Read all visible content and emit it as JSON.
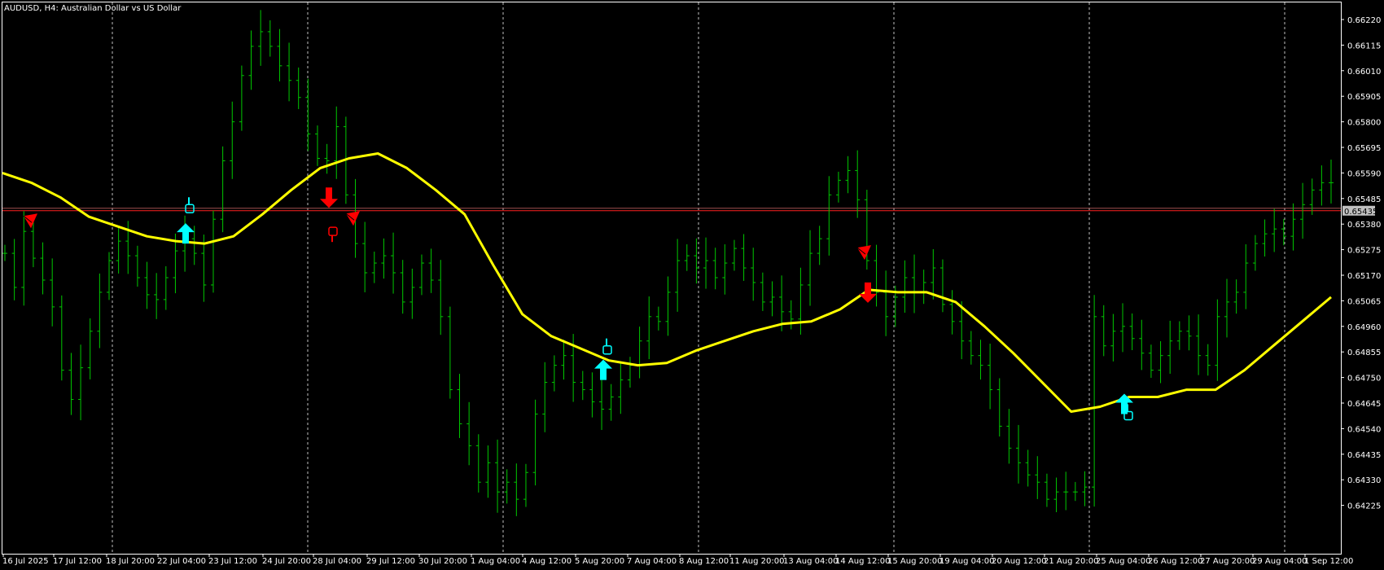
{
  "header": {
    "title": "AUDUSD, H4:  Australian Dollar vs US Dollar"
  },
  "colors": {
    "background": "#000000",
    "bars": "#00c800",
    "moving_average": "#ffff00",
    "buy_arrow": "#00ffff",
    "sell_arrow": "#ff0000",
    "bid_line": "#ff2020",
    "ask_line": "#a05050",
    "grid": "#c0c0c0",
    "bid_label_bg": "#c0c0c0"
  },
  "chart_data": {
    "type": "ohlc",
    "symbol": "AUDUSD",
    "timeframe": "H4",
    "ylim": [
      0.6417,
      0.6627
    ],
    "yticks": [
      "0.66220",
      "0.66115",
      "0.66010",
      "0.65905",
      "0.65800",
      "0.65695",
      "0.65590",
      "0.65485",
      "0.65380",
      "0.65275",
      "0.65170",
      "0.65065",
      "0.64960",
      "0.64855",
      "0.64750",
      "0.64645",
      "0.64540",
      "0.64435",
      "0.64330",
      "0.64225"
    ],
    "xticks": [
      "16 Jul 2025",
      "17 Jul 12:00",
      "18 Jul 20:00",
      "22 Jul 04:00",
      "23 Jul 12:00",
      "24 Jul 20:00",
      "28 Jul 04:00",
      "29 Jul 12:00",
      "30 Jul 20:00",
      "1 Aug 04:00",
      "4 Aug 12:00",
      "5 Aug 20:00",
      "7 Aug 04:00",
      "8 Aug 12:00",
      "11 Aug 20:00",
      "13 Aug 04:00",
      "14 Aug 12:00",
      "15 Aug 20:00",
      "19 Aug 04:00",
      "20 Aug 12:00",
      "21 Aug 20:00",
      "25 Aug 04:00",
      "26 Aug 12:00",
      "27 Aug 20:00",
      "29 Aug 04:00",
      "1 Sep 12:00"
    ],
    "bid_price": "0.65435",
    "bid_value": 0.65435,
    "ask_value": 0.65445,
    "grid": "vertical dashed lines at day separators",
    "price_path": [
      0.6526,
      0.6512,
      0.6535,
      0.6524,
      0.6515,
      0.6504,
      0.6478,
      0.6466,
      0.6479,
      0.6494,
      0.651,
      0.6523,
      0.6531,
      0.6525,
      0.6516,
      0.6509,
      0.6507,
      0.6516,
      0.6527,
      0.6532,
      0.6526,
      0.6513,
      0.654,
      0.6564,
      0.658,
      0.6599,
      0.6611,
      0.6617,
      0.6611,
      0.6603,
      0.6597,
      0.659,
      0.6575,
      0.6565,
      0.6564,
      0.6578,
      0.655,
      0.653,
      0.6518,
      0.6522,
      0.6525,
      0.6518,
      0.6506,
      0.6512,
      0.6522,
      0.6515,
      0.65,
      0.647,
      0.6456,
      0.6447,
      0.6432,
      0.644,
      0.6428,
      0.6432,
      0.6425,
      0.6436,
      0.646,
      0.6473,
      0.648,
      0.6484,
      0.6473,
      0.647,
      0.6465,
      0.6462,
      0.6467,
      0.6474,
      0.648,
      0.649,
      0.65,
      0.6498,
      0.651,
      0.6523,
      0.6525,
      0.652,
      0.6523,
      0.6516,
      0.6522,
      0.6528,
      0.652,
      0.6514,
      0.6506,
      0.6508,
      0.6502,
      0.6499,
      0.6513,
      0.6526,
      0.6532,
      0.655,
      0.6556,
      0.656,
      0.6548,
      0.6523,
      0.651,
      0.65,
      0.6508,
      0.6516,
      0.651,
      0.6514,
      0.652,
      0.6505,
      0.6498,
      0.649,
      0.6484,
      0.648,
      0.647,
      0.6455,
      0.6446,
      0.644,
      0.6435,
      0.6432,
      0.6425,
      0.6428,
      0.6428,
      0.6428,
      0.643,
      0.65,
      0.6488,
      0.6494,
      0.6496,
      0.6491,
      0.6485,
      0.6478,
      0.6484,
      0.649,
      0.6494,
      0.6492,
      0.6484,
      0.648,
      0.65,
      0.6506,
      0.651,
      0.6522,
      0.653,
      0.6534,
      0.6536,
      0.6533,
      0.654,
      0.6546,
      0.6552,
      0.6555,
      0.6555
    ],
    "moving_average": [
      0.6559,
      0.6555,
      0.6549,
      0.6541,
      0.6537,
      0.6533,
      0.6531,
      0.653,
      0.6533,
      0.6542,
      0.6552,
      0.6561,
      0.6565,
      0.6567,
      0.6561,
      0.6552,
      0.6542,
      0.6521,
      0.6501,
      0.6492,
      0.6487,
      0.6482,
      0.648,
      0.6481,
      0.6486,
      0.649,
      0.6494,
      0.6497,
      0.6498,
      0.6503,
      0.6511,
      0.651,
      0.651,
      0.6506,
      0.6496,
      0.6485,
      0.6473,
      0.6461,
      0.6463,
      0.6467,
      0.6467,
      0.647,
      0.647,
      0.6478,
      0.6488,
      0.6498,
      0.6508
    ],
    "series": [
      {
        "name": "AUDUSD",
        "kind": "ohlc bars"
      },
      {
        "name": "",
        "kind": "moving average line"
      }
    ],
    "markers": [
      {
        "type": "sell-small",
        "time": "16 Jul 2025",
        "price": 0.6539
      },
      {
        "type": "buy-arrow",
        "time": "22 Jul 04:00",
        "price": 0.6534
      },
      {
        "type": "buy-hand",
        "time": "22 Jul 04:00",
        "price": 0.6545
      },
      {
        "type": "sell-arrow",
        "time": "28 Jul 04:00",
        "price": 0.6549
      },
      {
        "type": "sell-small",
        "time": "28 Jul 04:00",
        "price": 0.654
      },
      {
        "type": "sell-hand",
        "time": "28 Jul 04:00",
        "price": 0.6534
      },
      {
        "type": "buy-arrow",
        "time": "5 Aug 20:00",
        "price": 0.6478
      },
      {
        "type": "buy-hand",
        "time": "5 Aug 20:00",
        "price": 0.6487
      },
      {
        "type": "sell-small",
        "time": "13 Aug 04:00",
        "price": 0.6526
      },
      {
        "type": "sell-arrow",
        "time": "14 Aug 12:00",
        "price": 0.651
      },
      {
        "type": "buy-arrow",
        "time": "25 Aug 04:00",
        "price": 0.6464
      },
      {
        "type": "buy-hand",
        "time": "25 Aug 04:00",
        "price": 0.646
      }
    ]
  }
}
